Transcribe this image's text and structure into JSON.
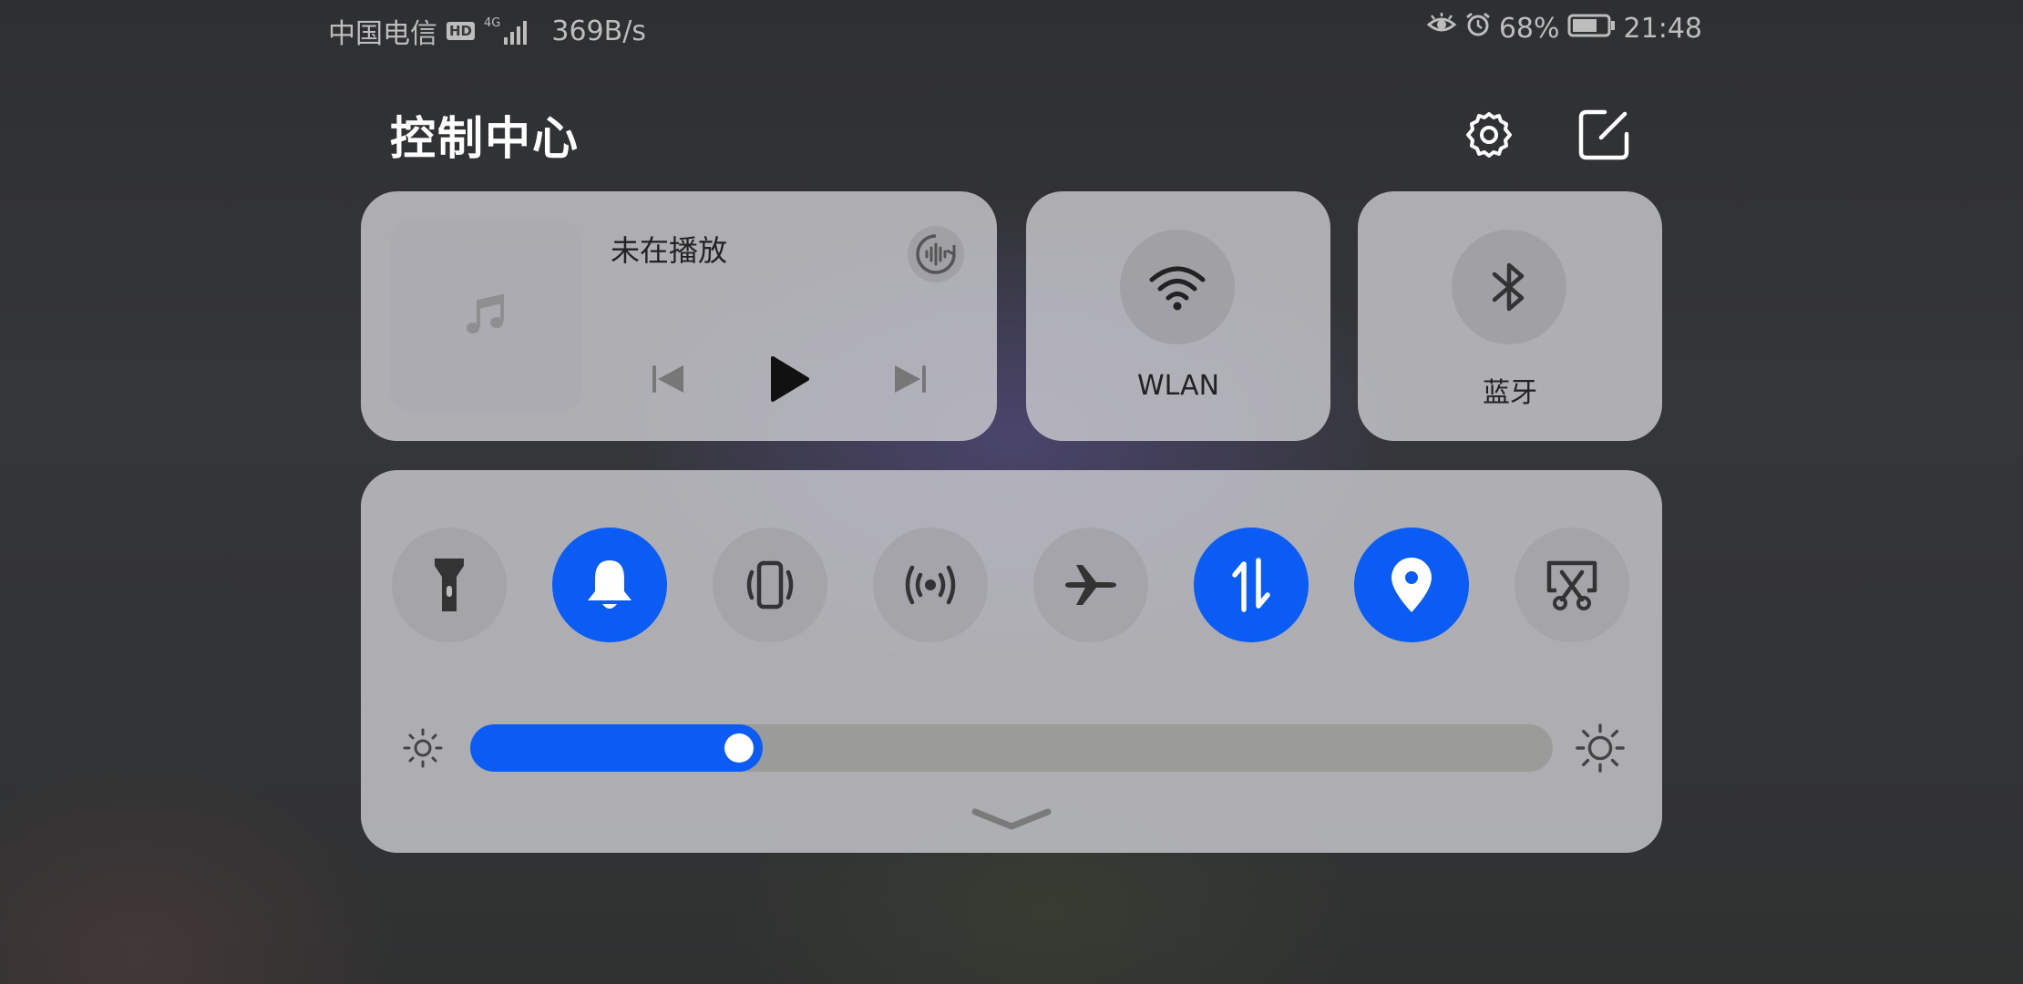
{
  "status_bar": {
    "carrier": "中国电信",
    "hd_badge": "HD",
    "network_type": "4G",
    "net_speed": "369B/s",
    "battery": "68%",
    "time": "21:48"
  },
  "header": {
    "title": "控制中心",
    "settings_icon": "gear-icon",
    "edit_icon": "edit-icon"
  },
  "media": {
    "status": "未在播放",
    "art_icon": "music-note-icon",
    "audio_icon": "audio-output-icon"
  },
  "tiles": [
    {
      "label": "WLAN",
      "icon": "wifi-icon"
    },
    {
      "label": "蓝牙",
      "icon": "bluetooth-icon"
    }
  ],
  "toggles": [
    {
      "icon": "flashlight-icon",
      "active": false
    },
    {
      "icon": "bell-icon",
      "active": true
    },
    {
      "icon": "vibrate-icon",
      "active": false
    },
    {
      "icon": "hotspot-icon",
      "active": false
    },
    {
      "icon": "airplane-icon",
      "active": false
    },
    {
      "icon": "mobile-data-icon",
      "active": true
    },
    {
      "icon": "location-icon",
      "active": true
    },
    {
      "icon": "screenshot-icon",
      "active": false
    }
  ],
  "brightness": {
    "level": 0.27
  },
  "colors": {
    "accent": "#0b5cf4",
    "panel": "#cdcdd2"
  }
}
